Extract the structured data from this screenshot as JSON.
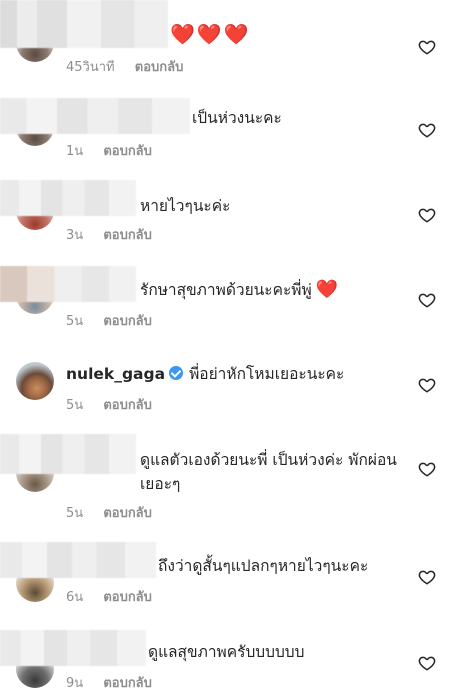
{
  "comments": [
    {
      "text": "",
      "hearts": "❤️❤️❤️",
      "time": "45วินาที",
      "reply": "ตอบกลับ"
    },
    {
      "text": "เป็นห่วงนะคะ",
      "time": "1น",
      "reply": "ตอบกลับ"
    },
    {
      "text": "หายไวๆนะค่ะ",
      "time": "3น",
      "reply": "ตอบกลับ"
    },
    {
      "text": "รักษาสุขภาพด้วยนะคะพี่พู่",
      "heart": "❤️",
      "time": "5น",
      "reply": "ตอบกลับ"
    },
    {
      "username": "nulek_gaga",
      "text": "พี่อย่าหักโหมเยอะนะคะ",
      "time": "5น",
      "reply": "ตอบกลับ",
      "verified": true
    },
    {
      "text": "ดูแลตัวเองด้วยนะพี่ เป็นห่วงค่ะ พักผ่อนเยอะๆ",
      "time": "5น",
      "reply": "ตอบกลับ"
    },
    {
      "text": "ถึงว่าดูสั้นๆแปลกๆหายไวๆนะคะ",
      "time": "6น",
      "reply": "ตอบกลับ"
    },
    {
      "text": "ดูแลสุขภาพครับบบบบบ",
      "time": "9น",
      "reply": "ตอบกลับ"
    }
  ],
  "icons": {
    "like": "heart-outline-icon",
    "verified": "verified-badge-icon"
  },
  "colors": {
    "text": "#262626",
    "meta": "#8e8e8e",
    "heart": "#ed4956",
    "verified": "#3897f0"
  }
}
